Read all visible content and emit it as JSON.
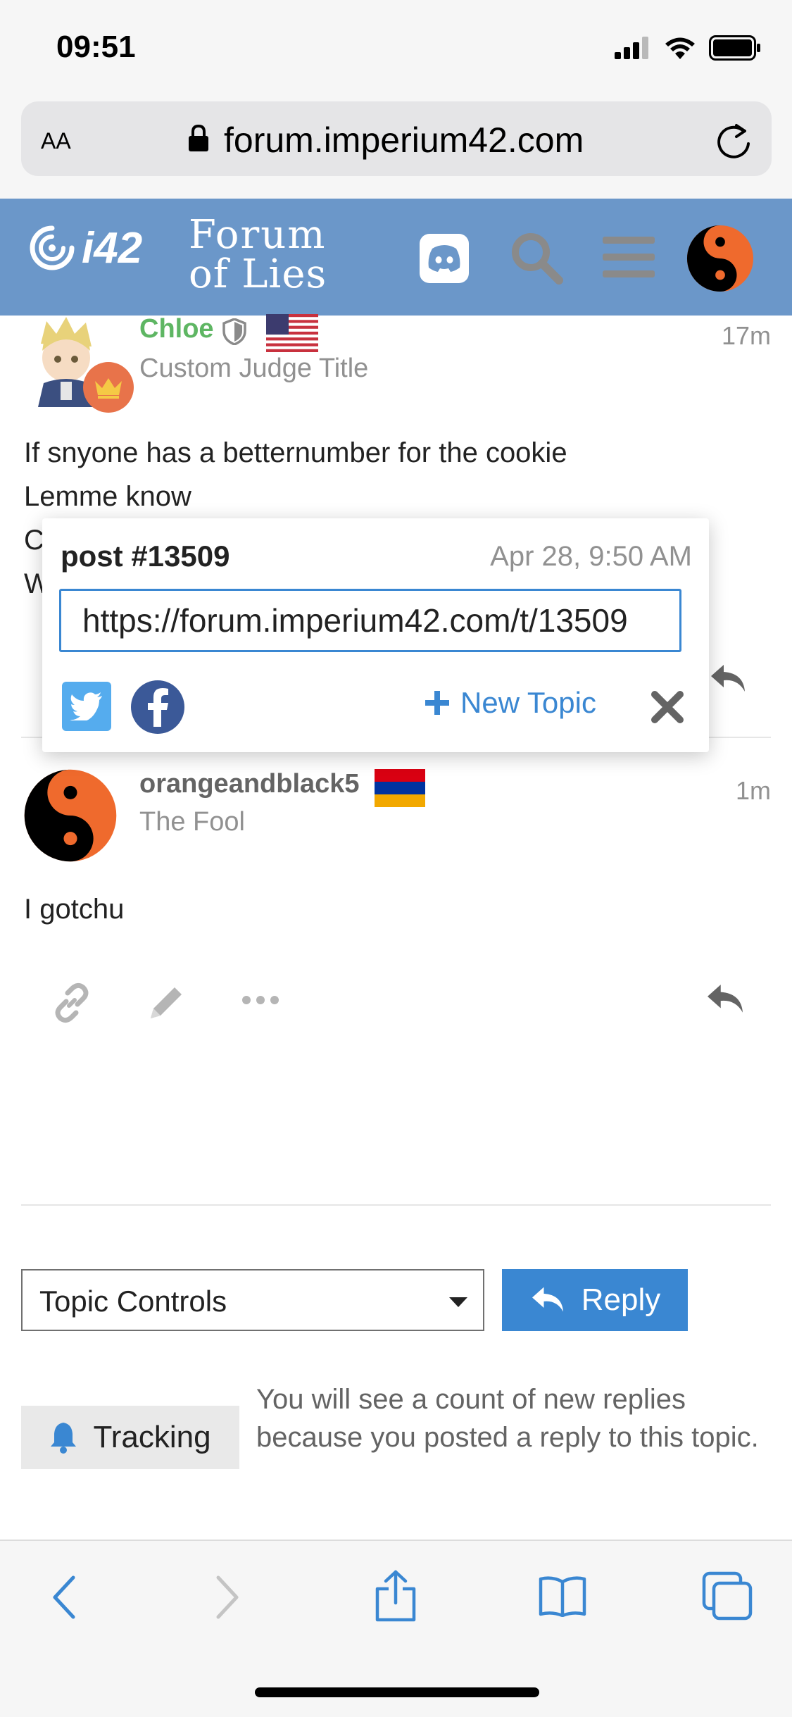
{
  "status_bar": {
    "time": "09:51"
  },
  "address_bar": {
    "aa": "AA",
    "url": "forum.imperium42.com"
  },
  "header": {
    "logo_text": "i42",
    "forum_title_line1": "Forum",
    "forum_title_line2": "of Lies"
  },
  "posts": [
    {
      "username": "Chloe",
      "user_title": "Custom Judge Title",
      "time": "17m",
      "body_lines": [
        "If snyone has a betternumber for the cookie",
        "Lemme know",
        "C",
        "W"
      ]
    },
    {
      "username": "orangeandblack5",
      "user_title": "The Fool",
      "time": "1m",
      "body_lines": [
        "I gotchu"
      ]
    }
  ],
  "share_popup": {
    "post_number": "post #13509",
    "date": "Apr 28, 9:50 AM",
    "url": "https://forum.imperium42.com/t/13509",
    "new_topic_label": "New Topic"
  },
  "topic_controls": {
    "label": "Topic Controls"
  },
  "reply_button": {
    "label": "Reply"
  },
  "tracking": {
    "label": "Tracking",
    "description": "You will see a count of new replies because you posted a reply to this topic."
  },
  "colors": {
    "header_bg": "#6b97c9",
    "accent": "#3a87d2",
    "chloe_name": "#5eb663"
  },
  "icons": {
    "post_actions": [
      "link-icon",
      "pencil-icon",
      "more-icon",
      "reply-icon"
    ],
    "toolbar": [
      "back-icon",
      "forward-icon",
      "share-icon",
      "bookmarks-icon",
      "tabs-icon"
    ]
  }
}
